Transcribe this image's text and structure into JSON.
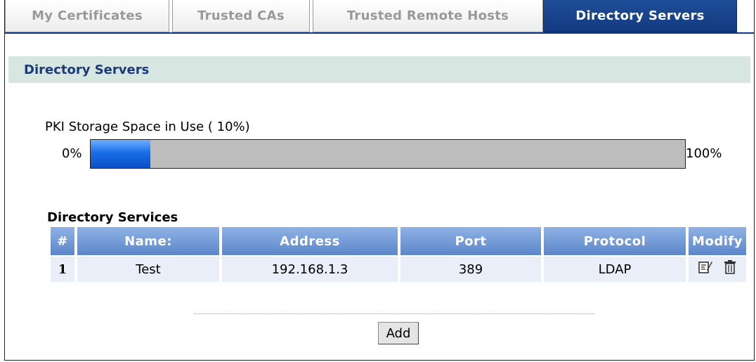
{
  "tabs": [
    {
      "label": "My Certificates",
      "active": false
    },
    {
      "label": "Trusted CAs",
      "active": false
    },
    {
      "label": "Trusted Remote Hosts",
      "active": false
    },
    {
      "label": "Directory Servers",
      "active": true
    }
  ],
  "section_title": "Directory Servers",
  "storage": {
    "label": "PKI Storage Space in Use ( 10%)",
    "min_label": "0%",
    "max_label": "100%",
    "value_percent": 10
  },
  "services": {
    "title": "Directory Services",
    "columns": [
      "#",
      "Name:",
      "Address",
      "Port",
      "Protocol",
      "Modify"
    ],
    "rows": [
      {
        "index": "1",
        "name": "Test",
        "address": "192.168.1.3",
        "port": "389",
        "protocol": "LDAP"
      }
    ]
  },
  "icons": {
    "edit": "edit-icon",
    "delete": "trash-icon"
  },
  "add_label": "Add",
  "colors": {
    "active_tab": "#123a80",
    "section_bar": "#d8e6e2",
    "header": "#5d86c9",
    "bar_fill": "#1a6ee8"
  }
}
